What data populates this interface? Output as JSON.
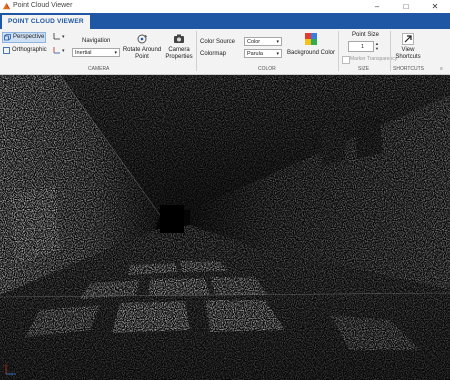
{
  "window": {
    "title": "Point Cloud Viewer"
  },
  "tab": {
    "label": "POINT CLOUD VIEWER"
  },
  "camera": {
    "perspective_label": "Perspective",
    "orthographic_label": "Orthographic",
    "navigation_label": "Navigation",
    "navigation_value": "Inertial",
    "rotate_label": "Rotate Around Point",
    "camera_label": "Camera Properties",
    "group_label": "CAMERA"
  },
  "color": {
    "source_label": "Color Source",
    "source_value": "Color",
    "colormap_label": "Colormap",
    "colormap_value": "Parula",
    "background_label": "Background Color",
    "group_label": "COLOR"
  },
  "size": {
    "point_size_label": "Point Size",
    "point_size_value": "1",
    "marker_label": "Marker Transparency",
    "group_label": "SIZE"
  },
  "shortcuts": {
    "view_label": "View Shortcuts",
    "group_label": "SHORTCUTS"
  },
  "colors": {
    "titlebar_tab": "#1f57a4",
    "ribbon_bg": "#f3f3f3"
  }
}
